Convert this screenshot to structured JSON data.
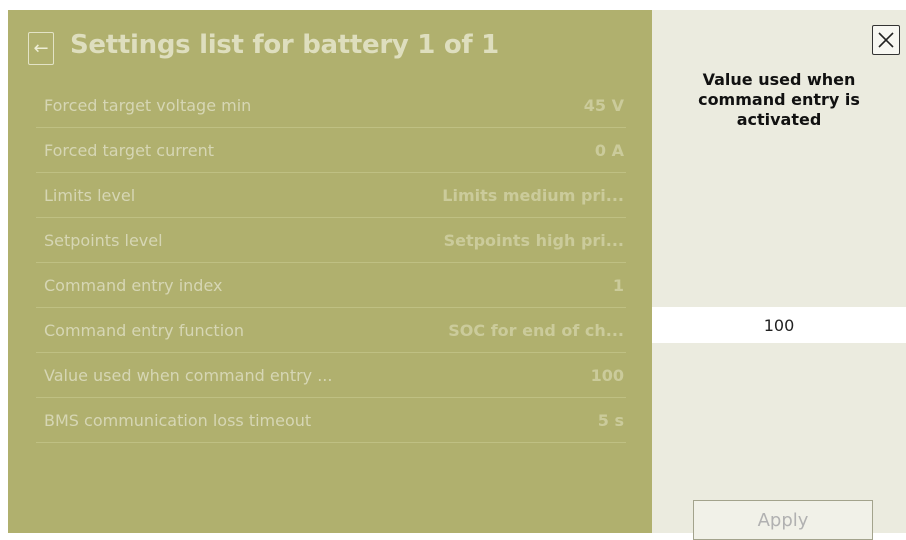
{
  "header": {
    "back_icon": "arrow-left-icon",
    "title": "Settings list for battery 1 of 1"
  },
  "settings": [
    {
      "label": "Forced target voltage min",
      "value": "45 V"
    },
    {
      "label": "Forced target current",
      "value": "0 A"
    },
    {
      "label": "Limits level",
      "value": "Limits medium pri..."
    },
    {
      "label": "Setpoints level",
      "value": "Setpoints high pri..."
    },
    {
      "label": "Command entry index",
      "value": "1"
    },
    {
      "label": "Command entry function",
      "value": "SOC for end of ch..."
    },
    {
      "label": "Value used when command entry ...",
      "value": "100"
    },
    {
      "label": "BMS communication loss timeout",
      "value": "5 s"
    }
  ],
  "panel": {
    "close_icon": "close-icon",
    "title": "Value used when command entry is activated",
    "input_value": "100",
    "apply_label": "Apply"
  }
}
